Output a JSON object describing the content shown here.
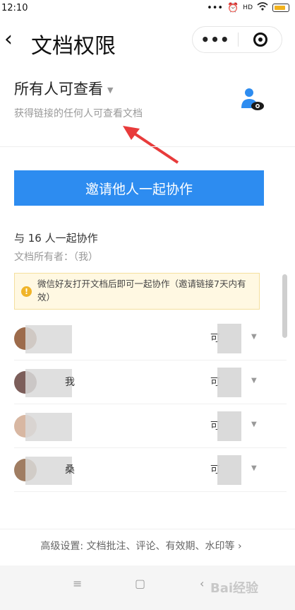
{
  "status": {
    "time": "12:10",
    "icons": [
      "more-dots-icon",
      "alarm-icon",
      "signal-icon",
      "wifi-icon",
      "battery-icon"
    ],
    "signal_label": "HD"
  },
  "header": {
    "back_icon": "chevron-left-icon",
    "title": "文档权限",
    "menu_icon": "more-dots-icon",
    "menu_glyph": "•••",
    "close_icon": "target-icon"
  },
  "permission": {
    "title": "所有人可查看",
    "caret": "▼",
    "subtitle": "获得链接的任何人可查看文档",
    "icon": "person-eye-icon"
  },
  "invite": {
    "label": "邀请他人一起协作"
  },
  "collaborators": {
    "count_label": "与 16 人一起协作",
    "owner_label": "文档所有者：（我）"
  },
  "tip": {
    "icon_glyph": "!",
    "text": "微信好友打开文档后即可一起协作（邀请链接7天内有效）"
  },
  "members": [
    {
      "name": "",
      "role": "可",
      "caret": "▼",
      "avatar_color": "#9d6b4b"
    },
    {
      "name": "我",
      "role": "可",
      "caret": "▼",
      "avatar_color": "#7c5e5a"
    },
    {
      "name": "",
      "role": "可",
      "caret": "▼",
      "avatar_color": "#d8b7a2"
    },
    {
      "name": "桑",
      "role": "可",
      "caret": "▼",
      "avatar_color": "#a07d62"
    }
  ],
  "advanced": {
    "label": "高级设置: 文档批注、评论、有效期、水印等 ›"
  },
  "navbar": {
    "menu_glyph": "≡",
    "home_glyph": "▢",
    "back_glyph": "‹"
  },
  "watermark": {
    "text": "Bai经验"
  },
  "colors": {
    "accent": "#2d8cf0",
    "tip_bg": "#fff8e2",
    "arrow": "#e83b3b"
  }
}
